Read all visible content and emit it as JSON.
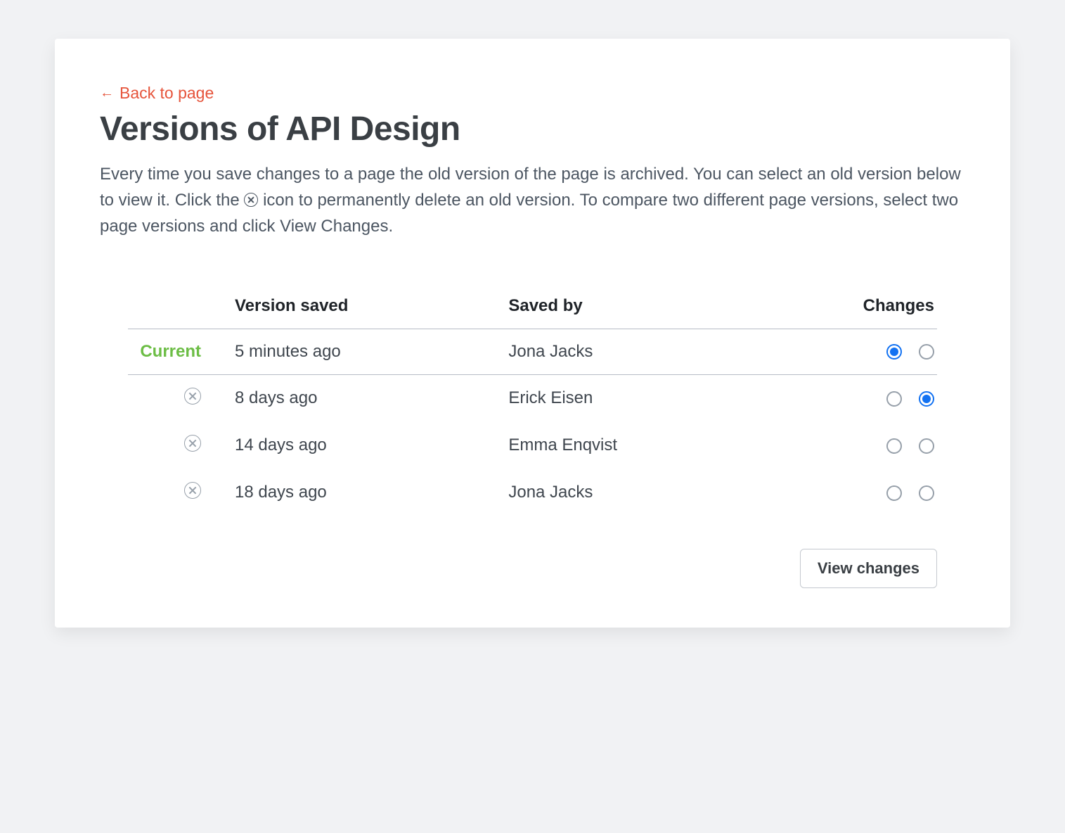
{
  "back_link": {
    "label": "Back to page"
  },
  "title": "Versions of API Design",
  "description": {
    "part1": "Every time you save changes to a page the old version of the page is archived. You can select an old version below to view it. Click the ",
    "part2": " icon to permanently delete an old version. To compare two different page versions, select two page versions and click View Changes."
  },
  "table": {
    "headers": {
      "version_saved": "Version saved",
      "saved_by": "Saved by",
      "changes": "Changes"
    },
    "current_label": "Current",
    "rows": [
      {
        "saved": "5 minutes ago",
        "by": "Jona Jacks",
        "is_current": true,
        "radio_a": true,
        "radio_b": false
      },
      {
        "saved": "8 days ago",
        "by": "Erick Eisen",
        "is_current": false,
        "radio_a": false,
        "radio_b": true
      },
      {
        "saved": "14 days ago",
        "by": "Emma Enqvist",
        "is_current": false,
        "radio_a": false,
        "radio_b": false
      },
      {
        "saved": "18 days ago",
        "by": "Jona Jacks",
        "is_current": false,
        "radio_a": false,
        "radio_b": false
      }
    ]
  },
  "view_changes_button": "View changes"
}
